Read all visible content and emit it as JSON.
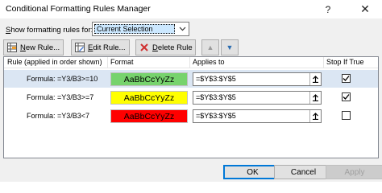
{
  "window": {
    "title": "Conditional Formatting Rules Manager",
    "help_glyph": "?",
    "close_glyph": "✕"
  },
  "show_rules": {
    "label_prefix": "",
    "label_underlined": "S",
    "label_rest": "how formatting rules for:",
    "selected": "Current Selection"
  },
  "toolbar": {
    "new_rule_underlined": "N",
    "new_rule_rest": "ew Rule...",
    "edit_rule_underlined": "E",
    "edit_rule_rest": "dit Rule...",
    "delete_rule_underlined": "D",
    "delete_rule_rest": "elete Rule",
    "move_up_glyph": "▲",
    "move_down_glyph": "▼"
  },
  "table": {
    "columns": {
      "rule": "Rule (applied in order shown)",
      "format": "Format",
      "applies_to": "Applies to",
      "stop_if_true": "Stop If True"
    },
    "rows": [
      {
        "rule": "Formula: =Y3/B3>=10",
        "preview": "AaBbCcYyZz",
        "fill": "#77d36d",
        "applies_to": "=$Y$3:$Y$5",
        "stop_if_true": true,
        "selected": true
      },
      {
        "rule": "Formula: =Y3/B3>=7",
        "preview": "AaBbCcYyZz",
        "fill": "#ffff00",
        "applies_to": "=$Y$3:$Y$5",
        "stop_if_true": true,
        "selected": false
      },
      {
        "rule": "Formula: =Y3/B3<7",
        "preview": "AaBbCcYyZz",
        "fill": "#ff0000",
        "applies_to": "=$Y$3:$Y$5",
        "stop_if_true": false,
        "selected": false
      }
    ]
  },
  "footer": {
    "ok": "OK",
    "cancel": "Cancel",
    "apply": "Apply"
  }
}
